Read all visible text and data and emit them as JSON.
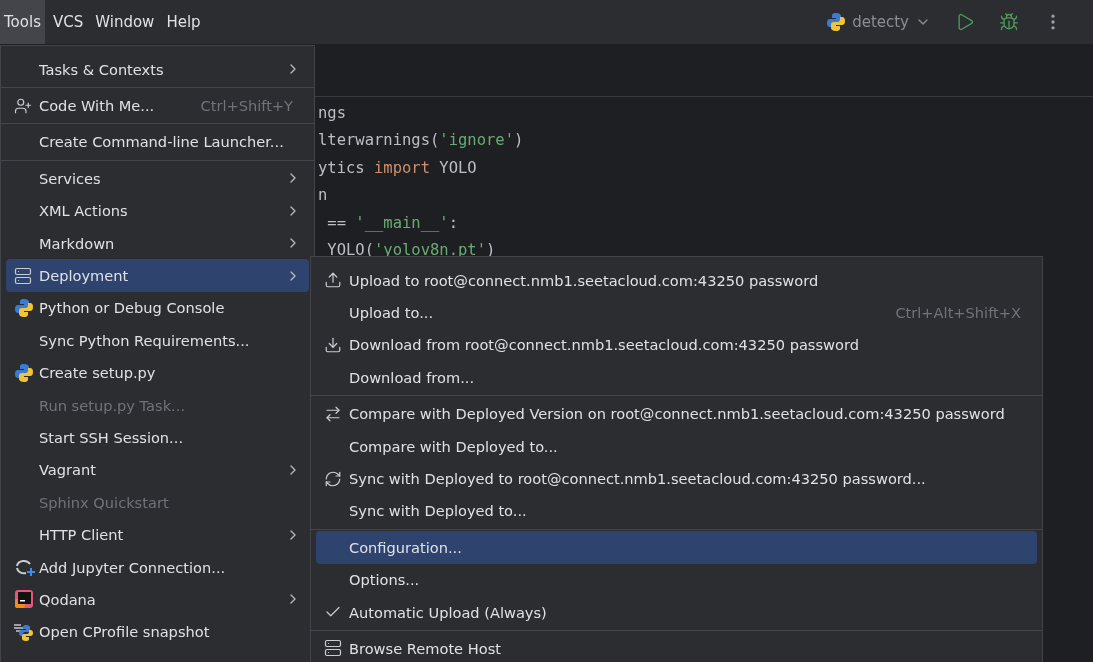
{
  "menubar": [
    {
      "label": "Tools",
      "selected": true
    },
    {
      "label": "VCS",
      "selected": false
    },
    {
      "label": "Window",
      "selected": false
    },
    {
      "label": "Help",
      "selected": false
    }
  ],
  "run_config": {
    "name": "detecty"
  },
  "editor": {
    "code_lines": [
      [
        {
          "text": "ngs",
          "kind": "plain"
        }
      ],
      [
        {
          "text": "lterwarnings(",
          "kind": "plain"
        },
        {
          "text": "'ignore'",
          "kind": "string"
        },
        {
          "text": ")",
          "kind": "plain"
        }
      ],
      [
        {
          "text": "ytics ",
          "kind": "plain"
        },
        {
          "text": "import",
          "kind": "keyword"
        },
        {
          "text": " YOLO",
          "kind": "plain"
        }
      ],
      [
        {
          "text": "n",
          "kind": "plain"
        }
      ],
      [
        {
          "text": " == ",
          "kind": "plain"
        },
        {
          "text": "'__main__'",
          "kind": "string"
        },
        {
          "text": ":",
          "kind": "plain"
        }
      ],
      [
        {
          "text": " YOLO(",
          "kind": "plain"
        },
        {
          "text": "'yolov8n.pt'",
          "kind": "string"
        },
        {
          "text": ")",
          "kind": "plain"
        }
      ]
    ]
  },
  "tools_menu": {
    "items": [
      {
        "kind": "item",
        "label": "Tasks & Contexts",
        "has_submenu": true,
        "selected": false,
        "disabled": false
      },
      {
        "kind": "separator"
      },
      {
        "kind": "item",
        "label": "Code With Me...",
        "shortcut": "Ctrl+Shift+Y",
        "has_submenu": false,
        "selected": false,
        "disabled": false
      },
      {
        "kind": "separator"
      },
      {
        "kind": "item",
        "label": "Create Command-line Launcher...",
        "has_submenu": false,
        "selected": false,
        "disabled": false
      },
      {
        "kind": "separator"
      },
      {
        "kind": "item",
        "label": "Services",
        "has_submenu": true,
        "selected": false,
        "disabled": false
      },
      {
        "kind": "item",
        "label": "XML Actions",
        "has_submenu": true,
        "selected": false,
        "disabled": false
      },
      {
        "kind": "item",
        "label": "Markdown",
        "has_submenu": true,
        "selected": false,
        "disabled": false
      },
      {
        "kind": "item",
        "label": "Deployment",
        "has_submenu": true,
        "selected": true,
        "disabled": false
      },
      {
        "kind": "item",
        "label": "Python or Debug Console",
        "has_submenu": false,
        "selected": false,
        "disabled": false
      },
      {
        "kind": "item",
        "label": "Sync Python Requirements...",
        "has_submenu": false,
        "selected": false,
        "disabled": false
      },
      {
        "kind": "item",
        "label": "Create setup.py",
        "has_submenu": false,
        "selected": false,
        "disabled": false
      },
      {
        "kind": "item",
        "label": "Run setup.py Task...",
        "has_submenu": false,
        "selected": false,
        "disabled": true
      },
      {
        "kind": "item",
        "label": "Start SSH Session...",
        "has_submenu": false,
        "selected": false,
        "disabled": false
      },
      {
        "kind": "item",
        "label": "Vagrant",
        "has_submenu": true,
        "selected": false,
        "disabled": false
      },
      {
        "kind": "item",
        "label": "Sphinx Quickstart",
        "has_submenu": false,
        "selected": false,
        "disabled": true
      },
      {
        "kind": "item",
        "label": "HTTP Client",
        "has_submenu": true,
        "selected": false,
        "disabled": false
      },
      {
        "kind": "item",
        "label": "Add Jupyter Connection...",
        "has_submenu": false,
        "selected": false,
        "disabled": false
      },
      {
        "kind": "item",
        "label": "Qodana",
        "has_submenu": true,
        "selected": false,
        "disabled": false
      },
      {
        "kind": "item",
        "label": "Open CProfile snapshot",
        "has_submenu": false,
        "selected": false,
        "disabled": false
      }
    ]
  },
  "deployment_submenu": {
    "items": [
      {
        "kind": "item",
        "label": "Upload to root@connect.nmb1.seetacloud.com:43250 password",
        "selected": false,
        "checked": false
      },
      {
        "kind": "item",
        "label": "Upload to...",
        "shortcut": "Ctrl+Alt+Shift+X",
        "selected": false,
        "checked": false
      },
      {
        "kind": "item",
        "label": "Download from root@connect.nmb1.seetacloud.com:43250 password",
        "selected": false,
        "checked": false
      },
      {
        "kind": "item",
        "label": "Download from...",
        "selected": false,
        "checked": false
      },
      {
        "kind": "separator"
      },
      {
        "kind": "item",
        "label": "Compare with Deployed Version on root@connect.nmb1.seetacloud.com:43250 password",
        "selected": false,
        "checked": false
      },
      {
        "kind": "item",
        "label": "Compare with Deployed to...",
        "selected": false,
        "checked": false
      },
      {
        "kind": "item",
        "label": "Sync with Deployed to root@connect.nmb1.seetacloud.com:43250 password...",
        "selected": false,
        "checked": false
      },
      {
        "kind": "item",
        "label": "Sync with Deployed to...",
        "selected": false,
        "checked": false
      },
      {
        "kind": "separator"
      },
      {
        "kind": "item",
        "label": "Configuration...",
        "selected": true,
        "checked": false
      },
      {
        "kind": "item",
        "label": "Options...",
        "selected": false,
        "checked": false
      },
      {
        "kind": "item",
        "label": "Automatic Upload (Always)",
        "selected": false,
        "checked": true
      },
      {
        "kind": "separator"
      },
      {
        "kind": "item",
        "label": "Browse Remote Host",
        "selected": false,
        "checked": false
      }
    ]
  }
}
